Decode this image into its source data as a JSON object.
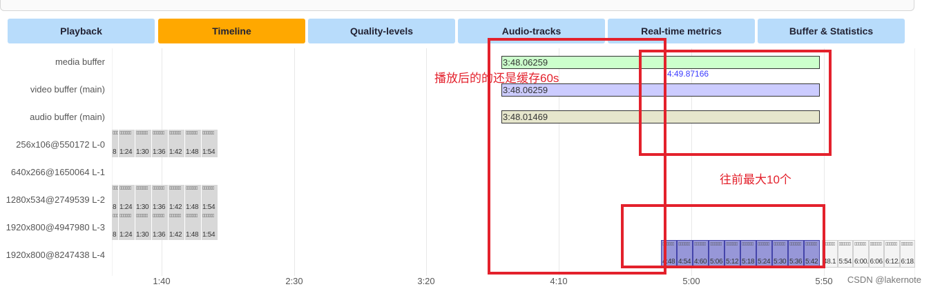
{
  "tabs": [
    "Playback",
    "Timeline",
    "Quality-levels",
    "Audio-tracks",
    "Real-time metrics",
    "Buffer & Statistics"
  ],
  "active_tab": "Timeline",
  "rows": [
    "media buffer",
    "video buffer (main)",
    "audio buffer (main)",
    "256x106@550172 L-0",
    "640x266@1650064 L-1",
    "1280x534@2749539 L-2",
    "1920x800@4947980 L-3",
    "1920x800@8247438 L-4"
  ],
  "axis_ticks": [
    "1:40",
    "2:30",
    "3:20",
    "4:10",
    "5:00",
    "5:50"
  ],
  "buffers": {
    "media_start": "3:48.06259",
    "media_end": "4:49.87166",
    "video_start": "3:48.06259",
    "audio_start": "3:48.01469"
  },
  "fragment_labels_low": [
    "8",
    "1:24",
    "1:30",
    "1:36",
    "1:42",
    "1:48",
    "1:54"
  ],
  "fragment_labels_l4": [
    "4:48",
    "4:54",
    "4:60",
    "5:06",
    "5:12",
    "5:18",
    "5:24",
    "5:30",
    "5:36",
    "5:42"
  ],
  "fragment_labels_l4_more": [
    "48.1",
    "5:54.1",
    "6:00.1",
    "6:06.1",
    "6:12.1",
    "6:18.1"
  ],
  "annotations": {
    "note_1": "播放后的的还是缓存60s",
    "note_2": "往前最大10个"
  },
  "watermark": "CSDN @lakernote",
  "colors": {
    "tab": "#b8dcfb",
    "tab_active": "#ffa800",
    "media_buffer": "#ccffcc",
    "video_buffer": "#ccccff",
    "audio_buffer": "#e6e6cc",
    "annotation": "#e3212c"
  }
}
